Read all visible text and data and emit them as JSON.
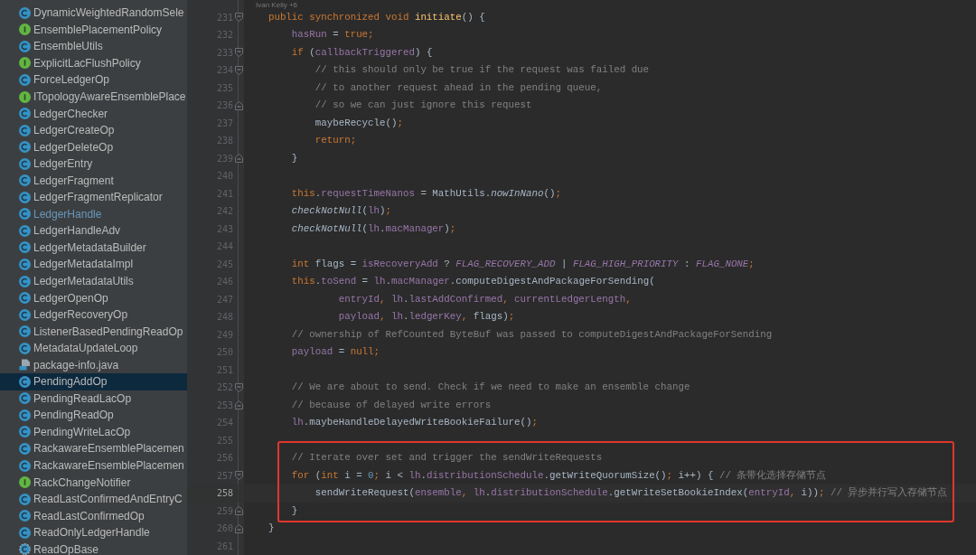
{
  "project_tree": {
    "items": [
      {
        "name": "DynamicWeightedRandomSele",
        "kind": "class",
        "selected": false,
        "modified": false
      },
      {
        "name": "EnsemblePlacementPolicy",
        "kind": "interface",
        "selected": false,
        "modified": false
      },
      {
        "name": "EnsembleUtils",
        "kind": "class",
        "selected": false,
        "modified": false
      },
      {
        "name": "ExplicitLacFlushPolicy",
        "kind": "interface",
        "selected": false,
        "modified": false
      },
      {
        "name": "ForceLedgerOp",
        "kind": "class",
        "selected": false,
        "modified": false
      },
      {
        "name": "ITopologyAwareEnsemblePlace",
        "kind": "interface",
        "selected": false,
        "modified": false
      },
      {
        "name": "LedgerChecker",
        "kind": "class",
        "selected": false,
        "modified": false
      },
      {
        "name": "LedgerCreateOp",
        "kind": "class",
        "selected": false,
        "modified": false
      },
      {
        "name": "LedgerDeleteOp",
        "kind": "class",
        "selected": false,
        "modified": false
      },
      {
        "name": "LedgerEntry",
        "kind": "class",
        "selected": false,
        "modified": false
      },
      {
        "name": "LedgerFragment",
        "kind": "class",
        "selected": false,
        "modified": false
      },
      {
        "name": "LedgerFragmentReplicator",
        "kind": "class",
        "selected": false,
        "modified": false
      },
      {
        "name": "LedgerHandle",
        "kind": "class",
        "selected": false,
        "modified": true
      },
      {
        "name": "LedgerHandleAdv",
        "kind": "class",
        "selected": false,
        "modified": false
      },
      {
        "name": "LedgerMetadataBuilder",
        "kind": "class",
        "selected": false,
        "modified": false
      },
      {
        "name": "LedgerMetadataImpl",
        "kind": "class",
        "selected": false,
        "modified": false
      },
      {
        "name": "LedgerMetadataUtils",
        "kind": "class",
        "selected": false,
        "modified": false
      },
      {
        "name": "LedgerOpenOp",
        "kind": "class",
        "selected": false,
        "modified": false
      },
      {
        "name": "LedgerRecoveryOp",
        "kind": "class",
        "selected": false,
        "modified": false
      },
      {
        "name": "ListenerBasedPendingReadOp",
        "kind": "class",
        "selected": false,
        "modified": false
      },
      {
        "name": "MetadataUpdateLoop",
        "kind": "class",
        "selected": false,
        "modified": false
      },
      {
        "name": "package-info.java",
        "kind": "file",
        "selected": false,
        "modified": false
      },
      {
        "name": "PendingAddOp",
        "kind": "class",
        "selected": true,
        "modified": false
      },
      {
        "name": "PendingReadLacOp",
        "kind": "class",
        "selected": false,
        "modified": false
      },
      {
        "name": "PendingReadOp",
        "kind": "class",
        "selected": false,
        "modified": false
      },
      {
        "name": "PendingWriteLacOp",
        "kind": "class",
        "selected": false,
        "modified": false
      },
      {
        "name": "RackawareEnsemblePlacemen",
        "kind": "class",
        "selected": false,
        "modified": false
      },
      {
        "name": "RackawareEnsemblePlacemen",
        "kind": "class",
        "selected": false,
        "modified": false
      },
      {
        "name": "RackChangeNotifier",
        "kind": "interface",
        "selected": false,
        "modified": false
      },
      {
        "name": "ReadLastConfirmedAndEntryC",
        "kind": "class",
        "selected": false,
        "modified": false
      },
      {
        "name": "ReadLastConfirmedOp",
        "kind": "class",
        "selected": false,
        "modified": false
      },
      {
        "name": "ReadOnlyLedgerHandle",
        "kind": "class",
        "selected": false,
        "modified": false
      },
      {
        "name": "ReadOpBase",
        "kind": "abstract",
        "selected": false,
        "modified": false
      }
    ]
  },
  "editor": {
    "author_hint": "Ivan Kelly +6",
    "lines": [
      {
        "number": "231",
        "fold_start": true,
        "fold_end": false,
        "boxed": false,
        "current": false,
        "tokens": [
          {
            "kind": "keyword",
            "text": "    public synchronized void "
          },
          {
            "kind": "decl",
            "text": "initiate"
          },
          {
            "kind": "plain",
            "text": "() {"
          }
        ]
      },
      {
        "number": "232",
        "fold_start": false,
        "fold_end": false,
        "boxed": false,
        "current": false,
        "tokens": [
          {
            "kind": "field",
            "text": "        hasRun"
          },
          {
            "kind": "plain",
            "text": " = "
          },
          {
            "kind": "keyword",
            "text": "true;"
          }
        ]
      },
      {
        "number": "233",
        "fold_start": true,
        "fold_end": false,
        "boxed": false,
        "current": false,
        "tokens": [
          {
            "kind": "keyword",
            "text": "        if "
          },
          {
            "kind": "plain",
            "text": "("
          },
          {
            "kind": "field",
            "text": "callbackTriggered"
          },
          {
            "kind": "plain",
            "text": ") {"
          }
        ]
      },
      {
        "number": "234",
        "fold_start": true,
        "fold_end": false,
        "boxed": false,
        "current": false,
        "tokens": [
          {
            "kind": "comment",
            "text": "            // this should only be true if the request was failed due"
          }
        ]
      },
      {
        "number": "235",
        "fold_start": false,
        "fold_end": false,
        "boxed": false,
        "current": false,
        "tokens": [
          {
            "kind": "comment",
            "text": "            // to another request ahead in the pending queue,"
          }
        ]
      },
      {
        "number": "236",
        "fold_start": false,
        "fold_end": true,
        "boxed": false,
        "current": false,
        "tokens": [
          {
            "kind": "comment",
            "text": "            // so we can just ignore this request"
          }
        ]
      },
      {
        "number": "237",
        "fold_start": false,
        "fold_end": false,
        "boxed": false,
        "current": false,
        "tokens": [
          {
            "kind": "plain",
            "text": "            maybeRecycle()"
          },
          {
            "kind": "keyword",
            "text": ";"
          }
        ]
      },
      {
        "number": "238",
        "fold_start": false,
        "fold_end": false,
        "boxed": false,
        "current": false,
        "tokens": [
          {
            "kind": "keyword",
            "text": "            return;"
          }
        ]
      },
      {
        "number": "239",
        "fold_start": false,
        "fold_end": true,
        "boxed": false,
        "current": false,
        "tokens": [
          {
            "kind": "plain",
            "text": "        }"
          }
        ]
      },
      {
        "number": "240",
        "fold_start": false,
        "fold_end": false,
        "boxed": false,
        "current": false
      },
      {
        "number": "241",
        "fold_start": false,
        "fold_end": false,
        "boxed": false,
        "current": false,
        "tokens": [
          {
            "kind": "keyword",
            "text": "        this"
          },
          {
            "kind": "plain",
            "text": "."
          },
          {
            "kind": "field",
            "text": "requestTimeNanos"
          },
          {
            "kind": "plain",
            "text": " = MathUtils."
          },
          {
            "kind": "static",
            "text": "nowInNano"
          },
          {
            "kind": "plain",
            "text": "()"
          },
          {
            "kind": "keyword",
            "text": ";"
          }
        ]
      },
      {
        "number": "242",
        "fold_start": false,
        "fold_end": false,
        "boxed": false,
        "current": false,
        "tokens": [
          {
            "kind": "static",
            "text": "        checkNotNull"
          },
          {
            "kind": "plain",
            "text": "("
          },
          {
            "kind": "field",
            "text": "lh"
          },
          {
            "kind": "plain",
            "text": ")"
          },
          {
            "kind": "keyword",
            "text": ";"
          }
        ]
      },
      {
        "number": "243",
        "fold_start": false,
        "fold_end": false,
        "boxed": false,
        "current": false,
        "tokens": [
          {
            "kind": "static",
            "text": "        checkNotNull"
          },
          {
            "kind": "plain",
            "text": "("
          },
          {
            "kind": "field",
            "text": "lh"
          },
          {
            "kind": "plain",
            "text": "."
          },
          {
            "kind": "field",
            "text": "macManager"
          },
          {
            "kind": "plain",
            "text": ")"
          },
          {
            "kind": "keyword",
            "text": ";"
          }
        ]
      },
      {
        "number": "244",
        "fold_start": false,
        "fold_end": false,
        "boxed": false,
        "current": false
      },
      {
        "number": "245",
        "fold_start": false,
        "fold_end": false,
        "boxed": false,
        "current": false,
        "tokens": [
          {
            "kind": "keyword",
            "text": "        int "
          },
          {
            "kind": "plain",
            "text": "flags = "
          },
          {
            "kind": "field",
            "text": "isRecoveryAdd"
          },
          {
            "kind": "plain",
            "text": " ? "
          },
          {
            "kind": "constant",
            "text": "FLAG_RECOVERY_ADD"
          },
          {
            "kind": "plain",
            "text": " | "
          },
          {
            "kind": "constant",
            "text": "FLAG_HIGH_PRIORITY"
          },
          {
            "kind": "plain",
            "text": " : "
          },
          {
            "kind": "constant",
            "text": "FLAG_NONE"
          },
          {
            "kind": "keyword",
            "text": ";"
          }
        ]
      },
      {
        "number": "246",
        "fold_start": false,
        "fold_end": false,
        "boxed": false,
        "current": false,
        "tokens": [
          {
            "kind": "keyword",
            "text": "        this"
          },
          {
            "kind": "plain",
            "text": "."
          },
          {
            "kind": "field",
            "text": "toSend"
          },
          {
            "kind": "plain",
            "text": " = "
          },
          {
            "kind": "field",
            "text": "lh"
          },
          {
            "kind": "plain",
            "text": "."
          },
          {
            "kind": "field",
            "text": "macManager"
          },
          {
            "kind": "plain",
            "text": ".computeDigestAndPackageForSending("
          }
        ]
      },
      {
        "number": "247",
        "fold_start": false,
        "fold_end": false,
        "boxed": false,
        "current": false,
        "tokens": [
          {
            "kind": "field",
            "text": "                entryId"
          },
          {
            "kind": "keyword",
            "text": ", "
          },
          {
            "kind": "field",
            "text": "lh"
          },
          {
            "kind": "plain",
            "text": "."
          },
          {
            "kind": "field",
            "text": "lastAddConfirmed"
          },
          {
            "kind": "keyword",
            "text": ", "
          },
          {
            "kind": "field",
            "text": "currentLedgerLength"
          },
          {
            "kind": "keyword",
            "text": ","
          }
        ]
      },
      {
        "number": "248",
        "fold_start": false,
        "fold_end": false,
        "boxed": false,
        "current": false,
        "tokens": [
          {
            "kind": "field",
            "text": "                payload"
          },
          {
            "kind": "keyword",
            "text": ", "
          },
          {
            "kind": "field",
            "text": "lh"
          },
          {
            "kind": "plain",
            "text": "."
          },
          {
            "kind": "field",
            "text": "ledgerKey"
          },
          {
            "kind": "keyword",
            "text": ", "
          },
          {
            "kind": "plain",
            "text": "flags)"
          },
          {
            "kind": "keyword",
            "text": ";"
          }
        ]
      },
      {
        "number": "249",
        "fold_start": false,
        "fold_end": false,
        "boxed": false,
        "current": false,
        "tokens": [
          {
            "kind": "comment",
            "text": "        // ownership of RefCounted ByteBuf was passed to computeDigestAndPackageForSending"
          }
        ]
      },
      {
        "number": "250",
        "fold_start": false,
        "fold_end": false,
        "boxed": false,
        "current": false,
        "tokens": [
          {
            "kind": "field",
            "text": "        payload"
          },
          {
            "kind": "plain",
            "text": " = "
          },
          {
            "kind": "keyword",
            "text": "null;"
          }
        ]
      },
      {
        "number": "251",
        "fold_start": false,
        "fold_end": false,
        "boxed": false,
        "current": false
      },
      {
        "number": "252",
        "fold_start": true,
        "fold_end": false,
        "boxed": false,
        "current": false,
        "tokens": [
          {
            "kind": "comment",
            "text": "        // We are about to send. Check if we need to make an ensemble change"
          }
        ]
      },
      {
        "number": "253",
        "fold_start": false,
        "fold_end": true,
        "boxed": false,
        "current": false,
        "tokens": [
          {
            "kind": "comment",
            "text": "        // because of delayed write errors"
          }
        ]
      },
      {
        "number": "254",
        "fold_start": false,
        "fold_end": false,
        "boxed": false,
        "current": false,
        "tokens": [
          {
            "kind": "field",
            "text": "        lh"
          },
          {
            "kind": "plain",
            "text": ".maybeHandleDelayedWriteBookieFailure()"
          },
          {
            "kind": "keyword",
            "text": ";"
          }
        ]
      },
      {
        "number": "255",
        "fold_start": false,
        "fold_end": false,
        "boxed": false,
        "current": false
      },
      {
        "number": "256",
        "fold_start": false,
        "fold_end": false,
        "boxed": true,
        "current": false,
        "tokens": [
          {
            "kind": "comment",
            "text": "        // Iterate over set and trigger the sendWriteRequests"
          }
        ]
      },
      {
        "number": "257",
        "fold_start": true,
        "fold_end": false,
        "boxed": true,
        "current": false,
        "tokens": [
          {
            "kind": "keyword",
            "text": "        for "
          },
          {
            "kind": "plain",
            "text": "("
          },
          {
            "kind": "keyword",
            "text": "int "
          },
          {
            "kind": "plain",
            "text": "i = "
          },
          {
            "kind": "number",
            "text": "0"
          },
          {
            "kind": "keyword",
            "text": "; "
          },
          {
            "kind": "plain",
            "text": "i < "
          },
          {
            "kind": "field",
            "text": "lh"
          },
          {
            "kind": "plain",
            "text": "."
          },
          {
            "kind": "field",
            "text": "distributionSchedule"
          },
          {
            "kind": "plain",
            "text": ".getWriteQuorumSize()"
          },
          {
            "kind": "keyword",
            "text": "; "
          },
          {
            "kind": "plain",
            "text": "i++) { "
          },
          {
            "kind": "comment",
            "text": "// 条带化选择存储节点"
          }
        ]
      },
      {
        "number": "258",
        "fold_start": false,
        "fold_end": false,
        "boxed": true,
        "current": true,
        "tokens": [
          {
            "kind": "plain",
            "text": "            sendWriteRequest("
          },
          {
            "kind": "field",
            "text": "ensemble"
          },
          {
            "kind": "keyword",
            "text": ", "
          },
          {
            "kind": "field",
            "text": "lh"
          },
          {
            "kind": "plain",
            "text": "."
          },
          {
            "kind": "field",
            "text": "distributionSchedule"
          },
          {
            "kind": "plain",
            "text": ".getWriteSetBookieIndex("
          },
          {
            "kind": "field",
            "text": "entryId"
          },
          {
            "kind": "keyword",
            "text": ", "
          },
          {
            "kind": "plain",
            "text": "i))"
          },
          {
            "kind": "keyword",
            "text": "; "
          },
          {
            "kind": "comment",
            "text": "// 异步并行写入存储节点"
          }
        ]
      },
      {
        "number": "259",
        "fold_start": false,
        "fold_end": true,
        "boxed": true,
        "current": false,
        "tokens": [
          {
            "kind": "plain",
            "text": "        }"
          }
        ]
      },
      {
        "number": "260",
        "fold_start": false,
        "fold_end": true,
        "boxed": false,
        "current": false,
        "tokens": [
          {
            "kind": "plain",
            "text": "    }"
          }
        ]
      },
      {
        "number": "261",
        "fold_start": false,
        "fold_end": false,
        "boxed": false,
        "current": false
      }
    ]
  }
}
